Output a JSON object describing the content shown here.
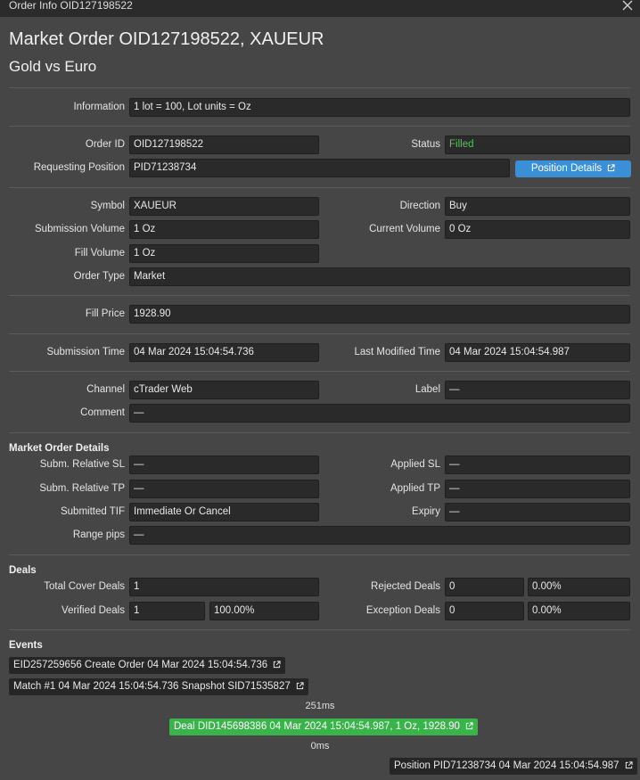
{
  "window": {
    "title": "Order Info OID127198522"
  },
  "header": {
    "title": "Market Order OID127198522, XAUEUR",
    "subtitle": "Gold vs Euro"
  },
  "info": {
    "label": "Information",
    "value": "1 lot = 100, Lot units = Oz"
  },
  "order": {
    "order_id_label": "Order ID",
    "order_id": "OID127198522",
    "status_label": "Status",
    "status": "Filled",
    "req_pos_label": "Requesting Position",
    "req_pos": "PID71238734",
    "position_details_button": "Position Details"
  },
  "trade": {
    "symbol_label": "Symbol",
    "symbol": "XAUEUR",
    "direction_label": "Direction",
    "direction": "Buy",
    "sub_vol_label": "Submission Volume",
    "sub_vol": "1 Oz",
    "cur_vol_label": "Current Volume",
    "cur_vol": "0 Oz",
    "fill_vol_label": "Fill Volume",
    "fill_vol": "1 Oz",
    "order_type_label": "Order Type",
    "order_type": "Market"
  },
  "price": {
    "fill_price_label": "Fill Price",
    "fill_price": "1928.90"
  },
  "times": {
    "sub_time_label": "Submission Time",
    "sub_time": "04 Mar 2024 15:04:54.736",
    "mod_time_label": "Last Modified Time",
    "mod_time": "04 Mar 2024 15:04:54.987"
  },
  "meta": {
    "channel_label": "Channel",
    "channel": "cTrader Web",
    "label_label": "Label",
    "label": "—",
    "comment_label": "Comment",
    "comment": "—"
  },
  "market_details": {
    "heading": "Market Order Details",
    "sub_sl_label": "Subm. Relative SL",
    "sub_sl": "—",
    "app_sl_label": "Applied SL",
    "app_sl": "—",
    "sub_tp_label": "Subm. Relative TP",
    "sub_tp": "—",
    "app_tp_label": "Applied TP",
    "app_tp": "—",
    "tif_label": "Submitted TIF",
    "tif": "Immediate Or Cancel",
    "expiry_label": "Expiry",
    "expiry": "—",
    "range_label": "Range pips",
    "range": "—"
  },
  "deals": {
    "heading": "Deals",
    "total_label": "Total Cover Deals",
    "total": "1",
    "rejected_label": "Rejected Deals",
    "rejected": "0",
    "rejected_pct": "0.00%",
    "verified_label": "Verified Deals",
    "verified": "1",
    "verified_pct": "100.00%",
    "exception_label": "Exception Deals",
    "exception": "0",
    "exception_pct": "0.00%"
  },
  "events": {
    "heading": "Events",
    "items": [
      "EID257259656 Create Order 04 Mar 2024 15:04:54.736",
      "Match #1 04 Mar 2024 15:04:54.736 Snapshot SID71535827",
      "Deal DID145698386 04 Mar 2024 15:04:54.987, 1 Oz, 1928.90",
      "Position PID71238734 04 Mar 2024 15:04:54.987"
    ],
    "gap1": "251ms",
    "gap2": "0ms"
  },
  "colors": {
    "accent": "#3a8fd6",
    "filled": "#56c45a",
    "deal": "#3bb34b"
  }
}
